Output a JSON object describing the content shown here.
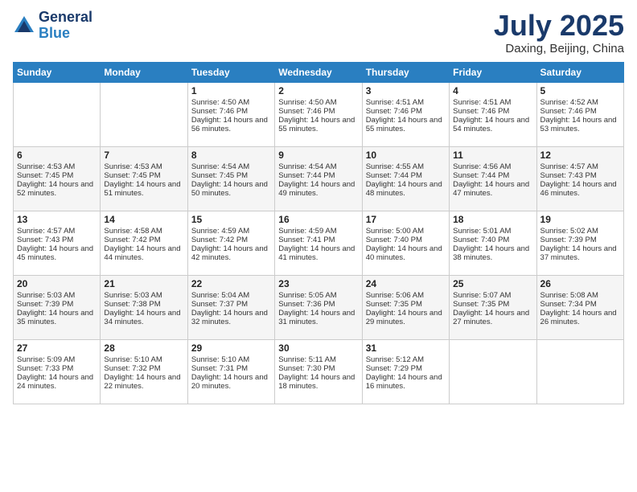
{
  "header": {
    "logo_line1": "General",
    "logo_line2": "Blue",
    "month": "July 2025",
    "location": "Daxing, Beijing, China"
  },
  "days_of_week": [
    "Sunday",
    "Monday",
    "Tuesday",
    "Wednesday",
    "Thursday",
    "Friday",
    "Saturday"
  ],
  "weeks": [
    [
      {
        "day": "",
        "sunrise": "",
        "sunset": "",
        "daylight": ""
      },
      {
        "day": "",
        "sunrise": "",
        "sunset": "",
        "daylight": ""
      },
      {
        "day": "1",
        "sunrise": "Sunrise: 4:50 AM",
        "sunset": "Sunset: 7:46 PM",
        "daylight": "Daylight: 14 hours and 56 minutes."
      },
      {
        "day": "2",
        "sunrise": "Sunrise: 4:50 AM",
        "sunset": "Sunset: 7:46 PM",
        "daylight": "Daylight: 14 hours and 55 minutes."
      },
      {
        "day": "3",
        "sunrise": "Sunrise: 4:51 AM",
        "sunset": "Sunset: 7:46 PM",
        "daylight": "Daylight: 14 hours and 55 minutes."
      },
      {
        "day": "4",
        "sunrise": "Sunrise: 4:51 AM",
        "sunset": "Sunset: 7:46 PM",
        "daylight": "Daylight: 14 hours and 54 minutes."
      },
      {
        "day": "5",
        "sunrise": "Sunrise: 4:52 AM",
        "sunset": "Sunset: 7:46 PM",
        "daylight": "Daylight: 14 hours and 53 minutes."
      }
    ],
    [
      {
        "day": "6",
        "sunrise": "Sunrise: 4:53 AM",
        "sunset": "Sunset: 7:45 PM",
        "daylight": "Daylight: 14 hours and 52 minutes."
      },
      {
        "day": "7",
        "sunrise": "Sunrise: 4:53 AM",
        "sunset": "Sunset: 7:45 PM",
        "daylight": "Daylight: 14 hours and 51 minutes."
      },
      {
        "day": "8",
        "sunrise": "Sunrise: 4:54 AM",
        "sunset": "Sunset: 7:45 PM",
        "daylight": "Daylight: 14 hours and 50 minutes."
      },
      {
        "day": "9",
        "sunrise": "Sunrise: 4:54 AM",
        "sunset": "Sunset: 7:44 PM",
        "daylight": "Daylight: 14 hours and 49 minutes."
      },
      {
        "day": "10",
        "sunrise": "Sunrise: 4:55 AM",
        "sunset": "Sunset: 7:44 PM",
        "daylight": "Daylight: 14 hours and 48 minutes."
      },
      {
        "day": "11",
        "sunrise": "Sunrise: 4:56 AM",
        "sunset": "Sunset: 7:44 PM",
        "daylight": "Daylight: 14 hours and 47 minutes."
      },
      {
        "day": "12",
        "sunrise": "Sunrise: 4:57 AM",
        "sunset": "Sunset: 7:43 PM",
        "daylight": "Daylight: 14 hours and 46 minutes."
      }
    ],
    [
      {
        "day": "13",
        "sunrise": "Sunrise: 4:57 AM",
        "sunset": "Sunset: 7:43 PM",
        "daylight": "Daylight: 14 hours and 45 minutes."
      },
      {
        "day": "14",
        "sunrise": "Sunrise: 4:58 AM",
        "sunset": "Sunset: 7:42 PM",
        "daylight": "Daylight: 14 hours and 44 minutes."
      },
      {
        "day": "15",
        "sunrise": "Sunrise: 4:59 AM",
        "sunset": "Sunset: 7:42 PM",
        "daylight": "Daylight: 14 hours and 42 minutes."
      },
      {
        "day": "16",
        "sunrise": "Sunrise: 4:59 AM",
        "sunset": "Sunset: 7:41 PM",
        "daylight": "Daylight: 14 hours and 41 minutes."
      },
      {
        "day": "17",
        "sunrise": "Sunrise: 5:00 AM",
        "sunset": "Sunset: 7:40 PM",
        "daylight": "Daylight: 14 hours and 40 minutes."
      },
      {
        "day": "18",
        "sunrise": "Sunrise: 5:01 AM",
        "sunset": "Sunset: 7:40 PM",
        "daylight": "Daylight: 14 hours and 38 minutes."
      },
      {
        "day": "19",
        "sunrise": "Sunrise: 5:02 AM",
        "sunset": "Sunset: 7:39 PM",
        "daylight": "Daylight: 14 hours and 37 minutes."
      }
    ],
    [
      {
        "day": "20",
        "sunrise": "Sunrise: 5:03 AM",
        "sunset": "Sunset: 7:39 PM",
        "daylight": "Daylight: 14 hours and 35 minutes."
      },
      {
        "day": "21",
        "sunrise": "Sunrise: 5:03 AM",
        "sunset": "Sunset: 7:38 PM",
        "daylight": "Daylight: 14 hours and 34 minutes."
      },
      {
        "day": "22",
        "sunrise": "Sunrise: 5:04 AM",
        "sunset": "Sunset: 7:37 PM",
        "daylight": "Daylight: 14 hours and 32 minutes."
      },
      {
        "day": "23",
        "sunrise": "Sunrise: 5:05 AM",
        "sunset": "Sunset: 7:36 PM",
        "daylight": "Daylight: 14 hours and 31 minutes."
      },
      {
        "day": "24",
        "sunrise": "Sunrise: 5:06 AM",
        "sunset": "Sunset: 7:35 PM",
        "daylight": "Daylight: 14 hours and 29 minutes."
      },
      {
        "day": "25",
        "sunrise": "Sunrise: 5:07 AM",
        "sunset": "Sunset: 7:35 PM",
        "daylight": "Daylight: 14 hours and 27 minutes."
      },
      {
        "day": "26",
        "sunrise": "Sunrise: 5:08 AM",
        "sunset": "Sunset: 7:34 PM",
        "daylight": "Daylight: 14 hours and 26 minutes."
      }
    ],
    [
      {
        "day": "27",
        "sunrise": "Sunrise: 5:09 AM",
        "sunset": "Sunset: 7:33 PM",
        "daylight": "Daylight: 14 hours and 24 minutes."
      },
      {
        "day": "28",
        "sunrise": "Sunrise: 5:10 AM",
        "sunset": "Sunset: 7:32 PM",
        "daylight": "Daylight: 14 hours and 22 minutes."
      },
      {
        "day": "29",
        "sunrise": "Sunrise: 5:10 AM",
        "sunset": "Sunset: 7:31 PM",
        "daylight": "Daylight: 14 hours and 20 minutes."
      },
      {
        "day": "30",
        "sunrise": "Sunrise: 5:11 AM",
        "sunset": "Sunset: 7:30 PM",
        "daylight": "Daylight: 14 hours and 18 minutes."
      },
      {
        "day": "31",
        "sunrise": "Sunrise: 5:12 AM",
        "sunset": "Sunset: 7:29 PM",
        "daylight": "Daylight: 14 hours and 16 minutes."
      },
      {
        "day": "",
        "sunrise": "",
        "sunset": "",
        "daylight": ""
      },
      {
        "day": "",
        "sunrise": "",
        "sunset": "",
        "daylight": ""
      }
    ]
  ]
}
